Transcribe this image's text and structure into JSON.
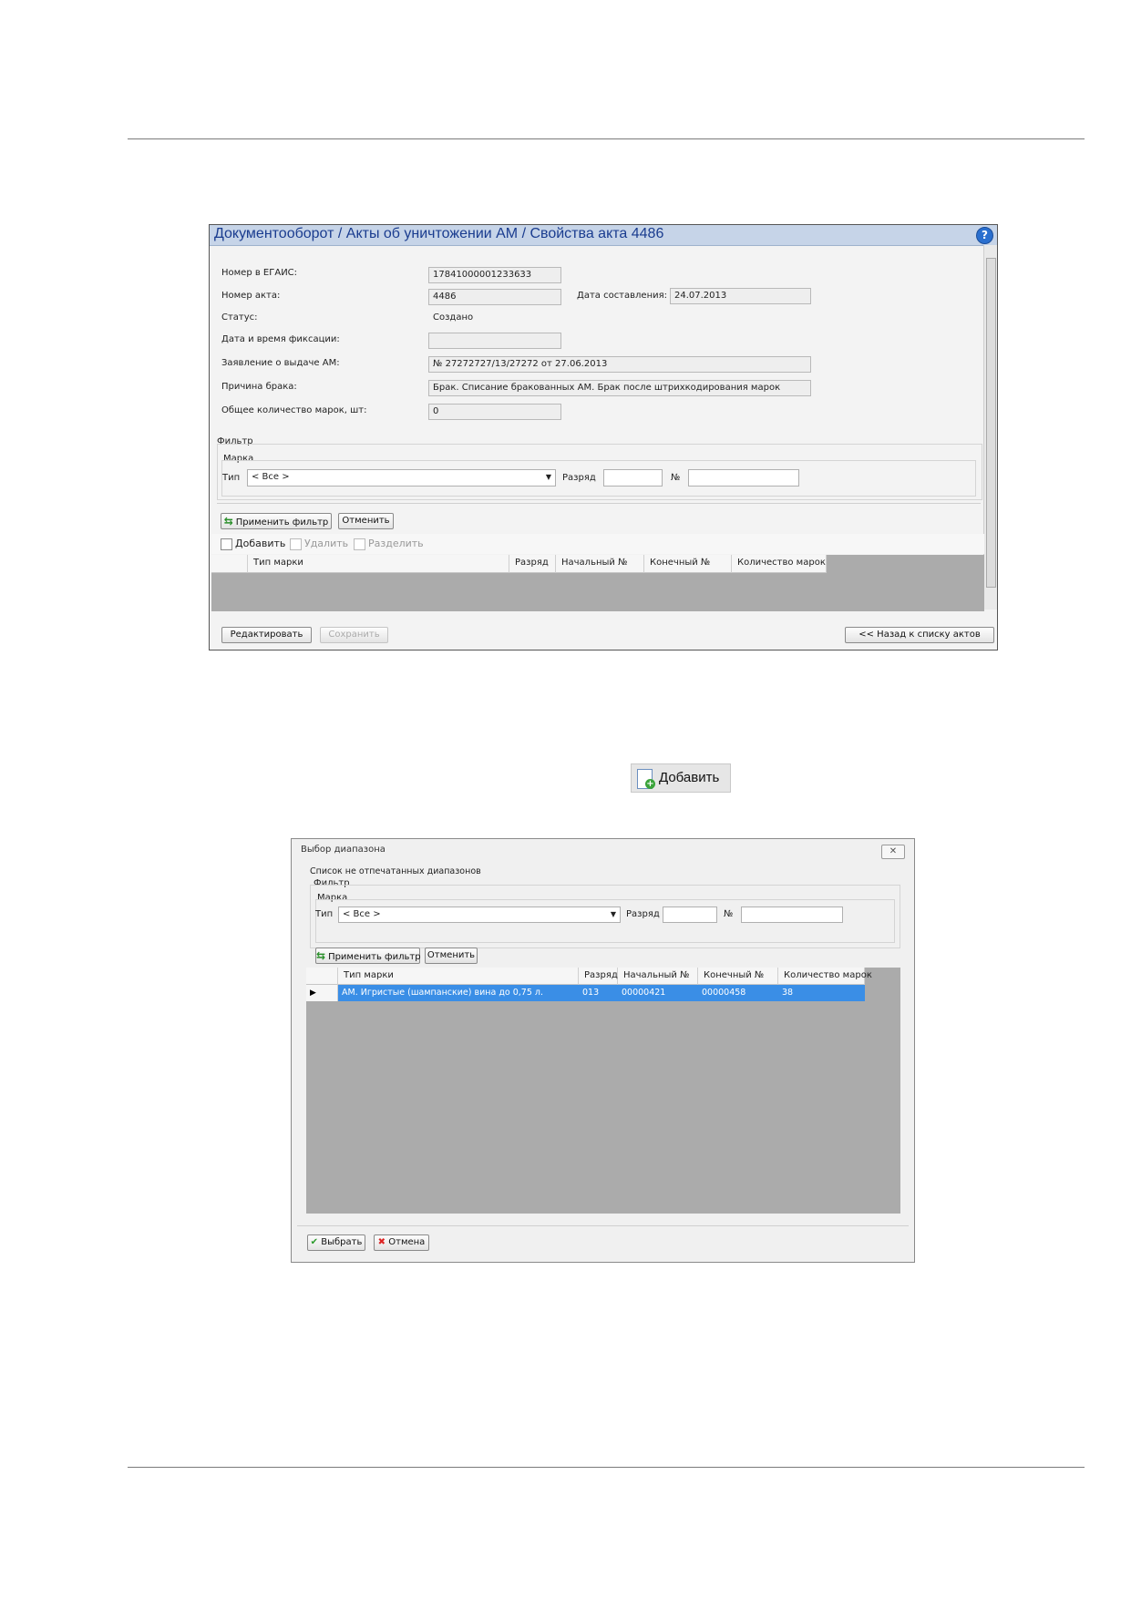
{
  "window_main": {
    "title": "Документооборот / Акты об уничтожении АМ / Свойства акта 4486",
    "help_icon": "?",
    "fields": {
      "egais_label": "Номер в ЕГАИС:",
      "egais_value": "17841000001233633",
      "act_number_label": "Номер акта:",
      "act_number_value": "4486",
      "date_label": "Дата составления:",
      "date_value": "24.07.2013",
      "status_label": "Статус:",
      "status_value": "Создано",
      "fix_datetime_label": "Дата и время фиксации:",
      "fix_datetime_value": "",
      "application_label": "Заявление о выдаче АМ:",
      "application_value": "№ 27272727/13/27272 от 27.06.2013",
      "reason_label": "Причина брака:",
      "reason_value": "Брак. Списание бракованных АМ. Брак после штрихкодирования марок",
      "total_label": "Общее количество марок, шт:",
      "total_value": "0"
    },
    "filter": {
      "group_label": "Фильтр",
      "mark_label": "Марка",
      "type_label": "Тип",
      "type_value": "< Все >",
      "rank_label": "Разряд",
      "number_label": "№",
      "apply_button": "Применить фильтр",
      "cancel_button": "Отменить"
    },
    "toolbar": {
      "add": "Добавить",
      "delete": "Удалить",
      "split": "Разделить"
    },
    "columns": [
      "Тип марки",
      "Разряд",
      "Начальный №",
      "Конечный №",
      "Количество марок"
    ],
    "footer": {
      "edit_button": "Редактировать",
      "save_button": "Сохранить",
      "back_button": "<< Назад к списку актов"
    }
  },
  "add_button_sample": {
    "label": "Добавить"
  },
  "window_range": {
    "title": "Выбор диапазона",
    "close_icon": "✕",
    "list_label": "Список не отпечатанных диапазонов",
    "filter": {
      "group_label": "Фильтр",
      "mark_label": "Марка",
      "type_label": "Тип",
      "type_value": "< Все >",
      "rank_label": "Разряд",
      "number_label": "№",
      "apply_button": "Применить фильтр",
      "cancel_button": "Отменить"
    },
    "columns": [
      "Тип марки",
      "Разряд",
      "Начальный №",
      "Конечный №",
      "Количество марок"
    ],
    "rows": [
      {
        "type": "АМ. Игристые (шампанские) вина до 0,75 л.",
        "rank": "013",
        "start": "00000421",
        "end": "00000458",
        "count": "38"
      }
    ],
    "footer": {
      "select_button": "Выбрать",
      "cancel_button": "Отмена"
    }
  },
  "colors": {
    "title_text": "#1a3c8f",
    "title_bar": "#c6d4e8",
    "selection": "#3a8ee6",
    "grid_empty": "#ababab"
  }
}
